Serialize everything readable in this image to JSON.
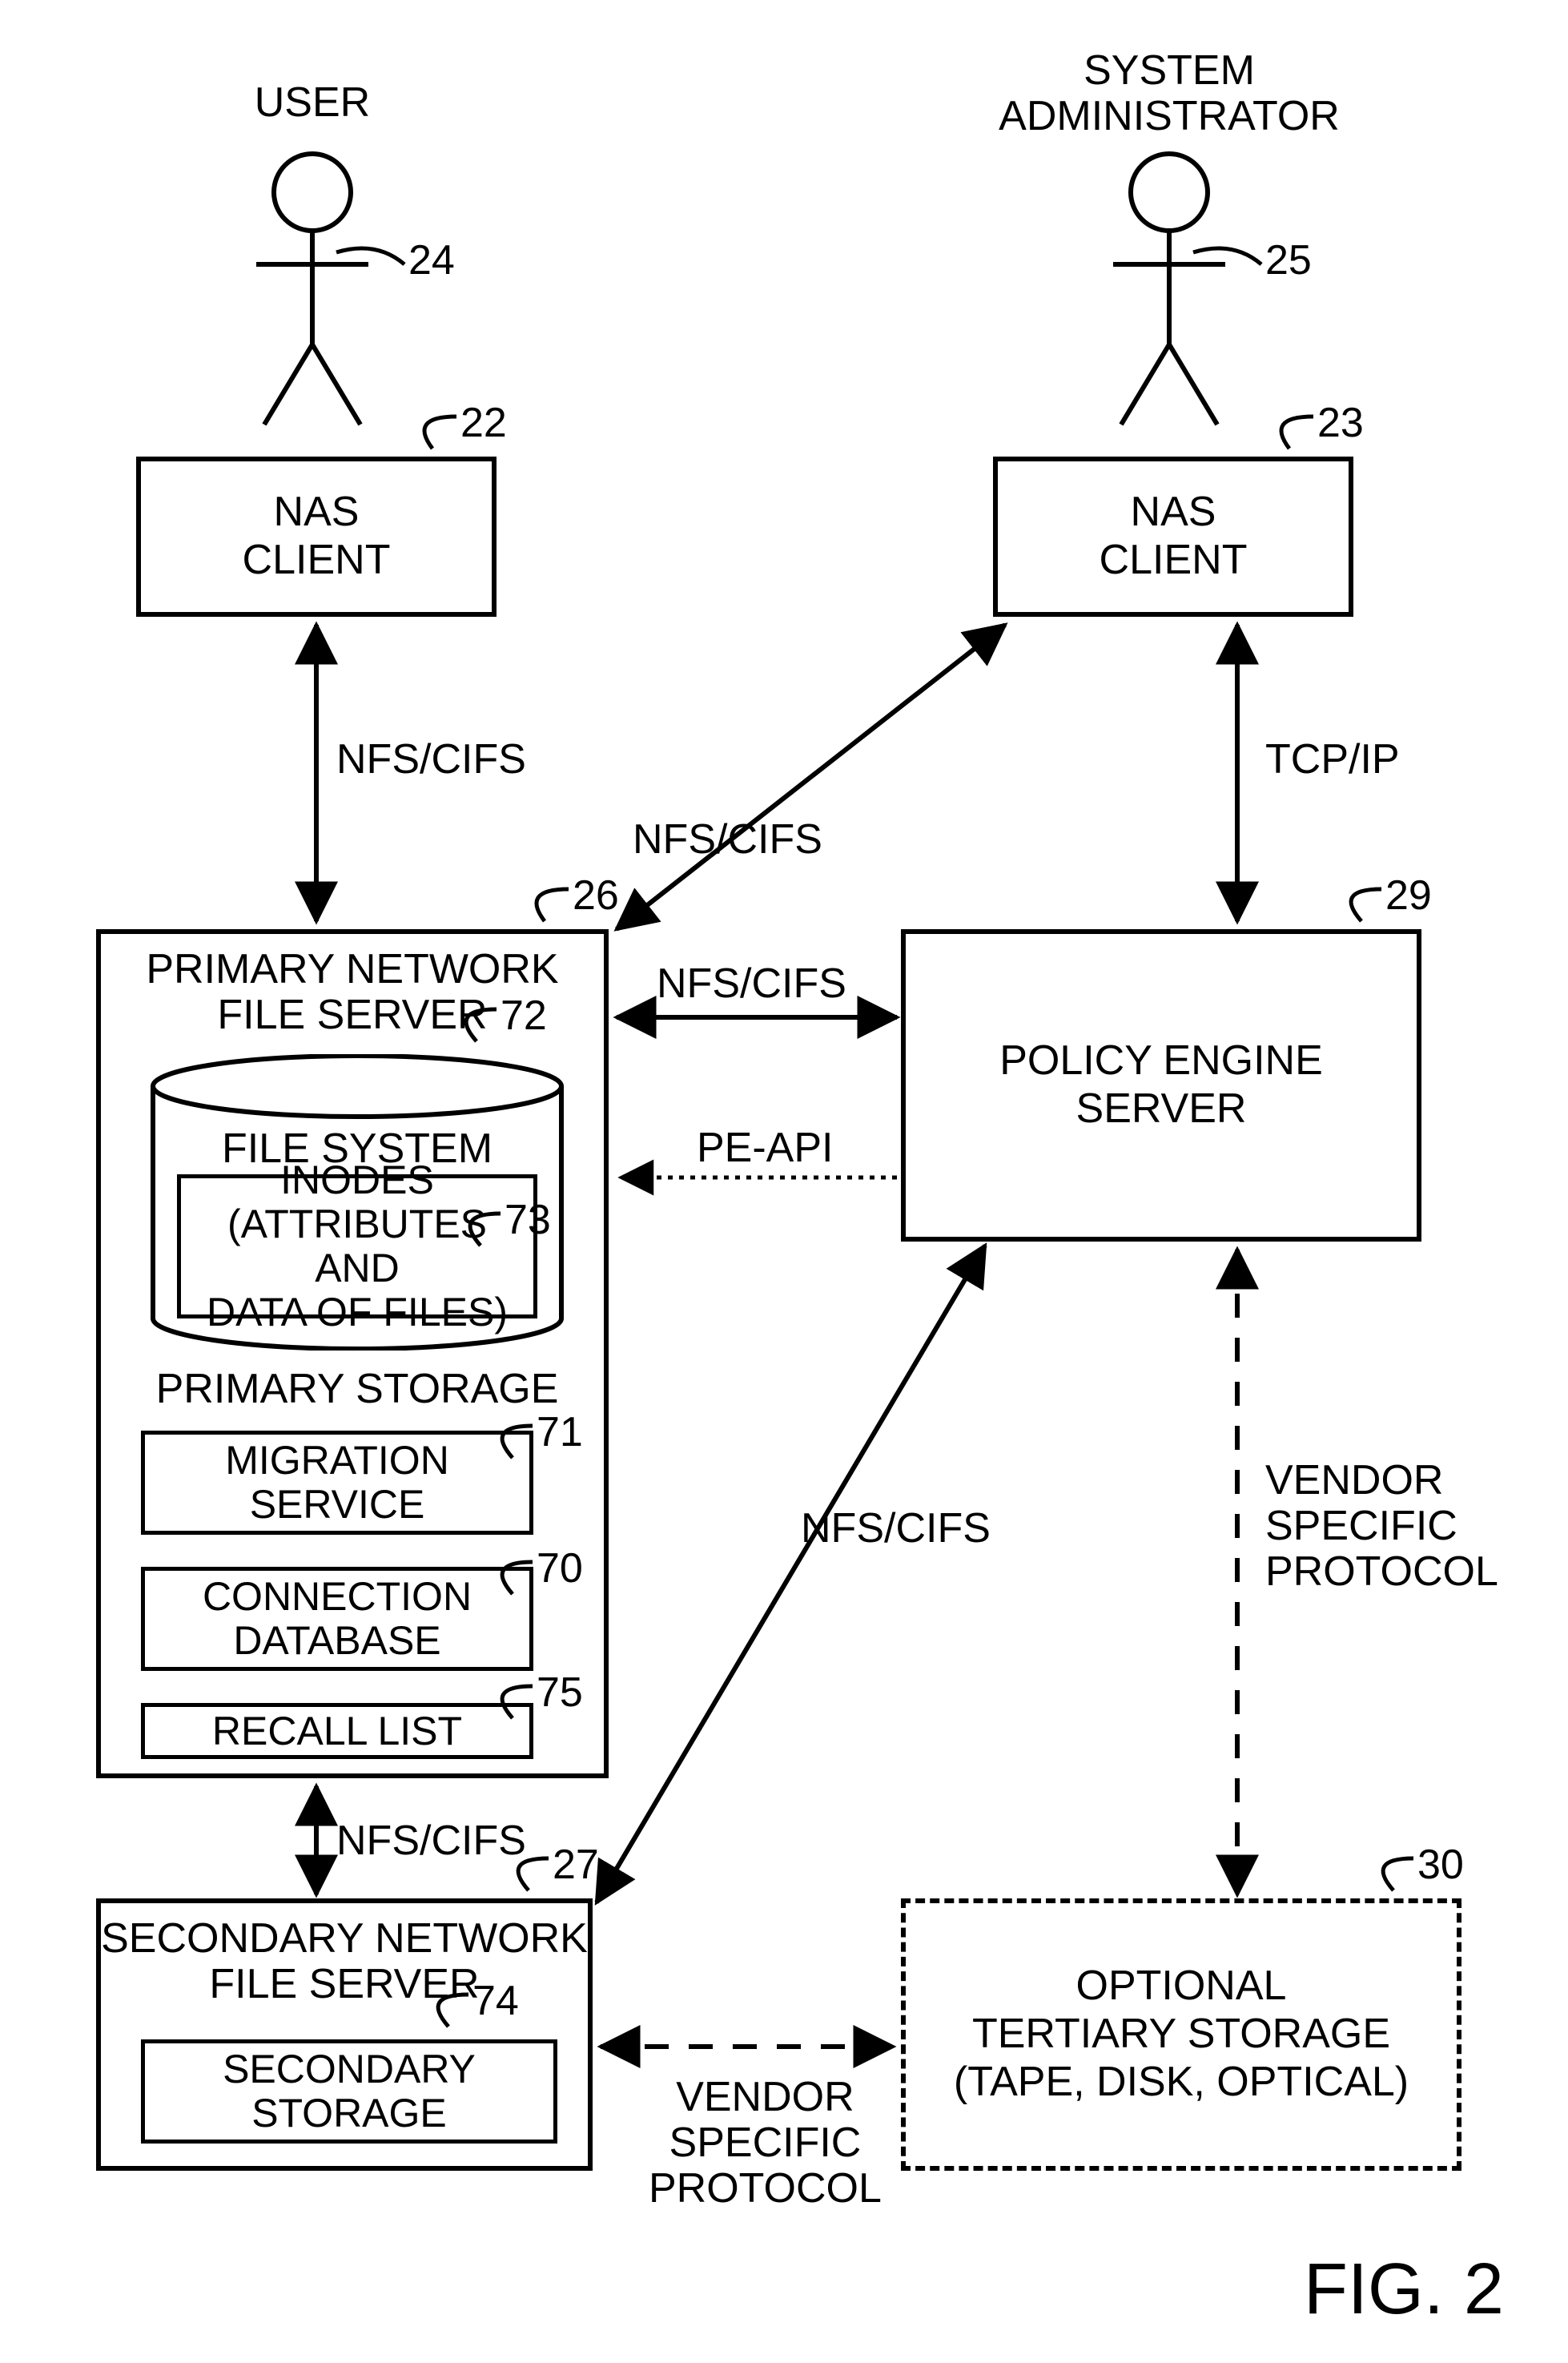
{
  "actors": {
    "user": {
      "label": "USER",
      "ref": "24"
    },
    "admin": {
      "label": "SYSTEM\nADMINISTRATOR",
      "ref": "25"
    }
  },
  "nodes": {
    "nas_client_1": {
      "label": "NAS\nCLIENT",
      "ref": "22"
    },
    "nas_client_2": {
      "label": "NAS\nCLIENT",
      "ref": "23"
    },
    "primary": {
      "title": "PRIMARY NETWORK\nFILE SERVER",
      "ref": "26",
      "storage": {
        "label": "FILE SYSTEM",
        "ref": "72",
        "inodes": {
          "label": "INODES\n(ATTRIBUTES AND\nDATA OF FILES)",
          "ref": "73"
        },
        "caption": "PRIMARY STORAGE"
      },
      "migration": {
        "label": "MIGRATION\nSERVICE",
        "ref": "71"
      },
      "conn_db": {
        "label": "CONNECTION\nDATABASE",
        "ref": "70"
      },
      "recall": {
        "label": "RECALL LIST",
        "ref": "75"
      }
    },
    "policy": {
      "label": "POLICY ENGINE\nSERVER",
      "ref": "29"
    },
    "secondary": {
      "title": "SECONDARY NETWORK\nFILE SERVER",
      "ref": "27",
      "storage": {
        "label": "SECONDARY\nSTORAGE",
        "ref": "74"
      }
    },
    "tertiary": {
      "label": "OPTIONAL\nTERTIARY STORAGE\n(TAPE, DISK, OPTICAL)",
      "ref": "30"
    }
  },
  "edges": {
    "nfs_cifs": "NFS/CIFS",
    "tcp_ip": "TCP/IP",
    "pe_api": "PE-API",
    "vendor": "VENDOR\nSPECIFIC\nPROTOCOL"
  },
  "figure": "FIG. 2",
  "chart_data": {
    "type": "diagram",
    "title": "FIG. 2",
    "nodes": [
      {
        "id": 24,
        "name": "USER",
        "kind": "actor"
      },
      {
        "id": 25,
        "name": "SYSTEM ADMINISTRATOR",
        "kind": "actor"
      },
      {
        "id": 22,
        "name": "NAS CLIENT",
        "kind": "component"
      },
      {
        "id": 23,
        "name": "NAS CLIENT",
        "kind": "component"
      },
      {
        "id": 26,
        "name": "PRIMARY NETWORK FILE SERVER",
        "kind": "component",
        "children": [
          {
            "id": 72,
            "name": "FILE SYSTEM / PRIMARY STORAGE",
            "kind": "datastore",
            "children": [
              {
                "id": 73,
                "name": "INODES (ATTRIBUTES AND DATA OF FILES)",
                "kind": "data"
              }
            ]
          },
          {
            "id": 71,
            "name": "MIGRATION SERVICE",
            "kind": "module"
          },
          {
            "id": 70,
            "name": "CONNECTION DATABASE",
            "kind": "module"
          },
          {
            "id": 75,
            "name": "RECALL LIST",
            "kind": "module"
          }
        ]
      },
      {
        "id": 29,
        "name": "POLICY ENGINE SERVER",
        "kind": "component"
      },
      {
        "id": 27,
        "name": "SECONDARY NETWORK FILE SERVER",
        "kind": "component",
        "children": [
          {
            "id": 74,
            "name": "SECONDARY STORAGE",
            "kind": "datastore"
          }
        ]
      },
      {
        "id": 30,
        "name": "OPTIONAL TERTIARY STORAGE (TAPE, DISK, OPTICAL)",
        "kind": "component",
        "optional": true
      }
    ],
    "edges": [
      {
        "from": 24,
        "to": 22,
        "label": "",
        "style": "solid"
      },
      {
        "from": 25,
        "to": 23,
        "label": "",
        "style": "solid"
      },
      {
        "from": 22,
        "to": 26,
        "label": "NFS/CIFS",
        "style": "solid",
        "dir": "both"
      },
      {
        "from": 23,
        "to": 26,
        "label": "NFS/CIFS",
        "style": "solid",
        "dir": "both"
      },
      {
        "from": 23,
        "to": 29,
        "label": "TCP/IP",
        "style": "solid",
        "dir": "both"
      },
      {
        "from": 26,
        "to": 29,
        "label": "NFS/CIFS",
        "style": "solid",
        "dir": "both"
      },
      {
        "from": 29,
        "to": 26,
        "label": "PE-API",
        "style": "dotted",
        "dir": "to"
      },
      {
        "from": 29,
        "to": 27,
        "label": "NFS/CIFS",
        "style": "solid",
        "dir": "both"
      },
      {
        "from": 26,
        "to": 27,
        "label": "NFS/CIFS",
        "style": "solid",
        "dir": "both"
      },
      {
        "from": 29,
        "to": 30,
        "label": "VENDOR SPECIFIC PROTOCOL",
        "style": "dashed",
        "dir": "both"
      },
      {
        "from": 27,
        "to": 30,
        "label": "VENDOR SPECIFIC PROTOCOL",
        "style": "dashed",
        "dir": "both"
      }
    ]
  }
}
